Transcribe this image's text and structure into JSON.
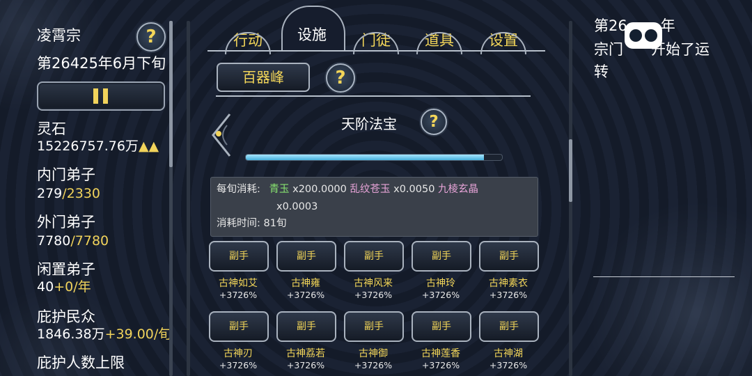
{
  "sidebar": {
    "sect_name": "凌霄宗",
    "date": "第26425年6月下旬",
    "spirit_stone": {
      "label": "灵石",
      "value": "15226757.76万",
      "arrows": "▲▲"
    },
    "inner_disciples": {
      "label": "内门弟子",
      "current": "279",
      "max": "/2330"
    },
    "outer_disciples": {
      "label": "外门弟子",
      "current": "7780",
      "max": "/7780"
    },
    "idle_disciples": {
      "label": "闲置弟子",
      "current": "40",
      "rate": "+0/年"
    },
    "protected": {
      "label": "庇护民众",
      "current": "1846.38万",
      "rate": "+39.00/旬"
    },
    "protect_limit": {
      "label": "庇护人数上限"
    }
  },
  "tabs": {
    "action": "行动",
    "facilities": "设施",
    "disciples": "门徒",
    "items": "道具",
    "settings": "设置"
  },
  "facility": {
    "name": "百器峰",
    "section_title": "天阶法宝",
    "progress": 0.93
  },
  "cost": {
    "per_turn_label": "每旬消耗:",
    "item1": "青玉",
    "item1_qty": "x200.0000",
    "item2": "乱纹苍玉",
    "item2_qty": "x0.0050",
    "item3": "九棱玄晶",
    "item3_qty": "x0.0003",
    "time_label": "消耗时间:",
    "time_value": "81旬"
  },
  "helpers": [
    {
      "button": "副手",
      "name": "古神如艾",
      "bonus": "+3726%"
    },
    {
      "button": "副手",
      "name": "古神雍",
      "bonus": "+3726%"
    },
    {
      "button": "副手",
      "name": "古神风来",
      "bonus": "+3726%"
    },
    {
      "button": "副手",
      "name": "古神玲",
      "bonus": "+3726%"
    },
    {
      "button": "副手",
      "name": "古神素衣",
      "bonus": "+3726%"
    },
    {
      "button": "副手",
      "name": "古神刃",
      "bonus": "+3726%"
    },
    {
      "button": "副手",
      "name": "古神荔若",
      "bonus": "+3726%"
    },
    {
      "button": "副手",
      "name": "古神御",
      "bonus": "+3726%"
    },
    {
      "button": "副手",
      "name": "古神莲香",
      "bonus": "+3726%"
    },
    {
      "button": "副手",
      "name": "古神湖",
      "bonus": "+3726%"
    }
  ],
  "log": {
    "line1": "第26",
    "line1b": "年",
    "line2": "宗门",
    "line2b": "开始了运",
    "line3": "转"
  },
  "icons": {
    "help": "?",
    "accent": "#f1d35b"
  }
}
